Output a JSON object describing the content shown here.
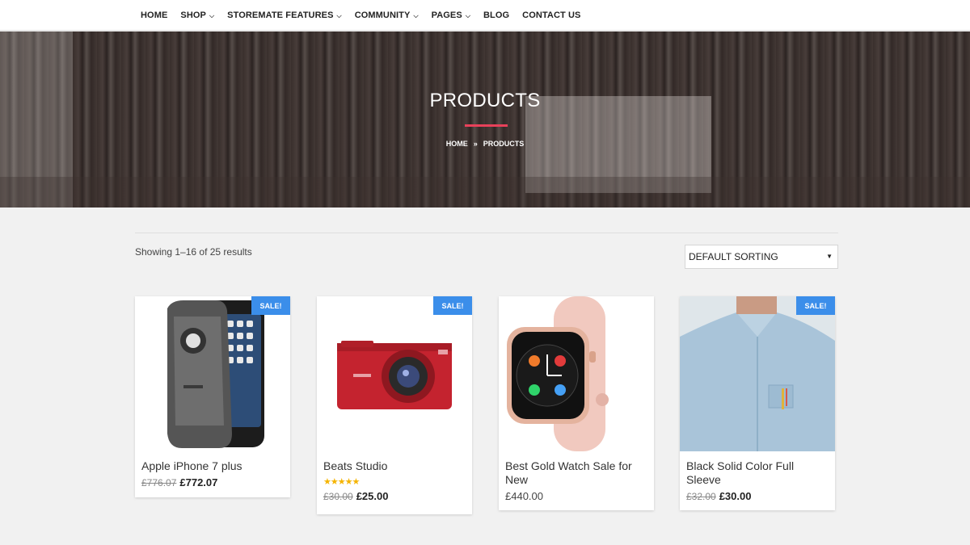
{
  "nav": {
    "items": [
      {
        "label": "HOME",
        "dropdown": false
      },
      {
        "label": "SHOP",
        "dropdown": true
      },
      {
        "label": "STOREMATE FEATURES",
        "dropdown": true
      },
      {
        "label": "COMMUNITY",
        "dropdown": true
      },
      {
        "label": "PAGES",
        "dropdown": true
      },
      {
        "label": "BLOG",
        "dropdown": false
      },
      {
        "label": "CONTACT US",
        "dropdown": false
      }
    ]
  },
  "hero": {
    "title": "PRODUCTS",
    "breadcrumb": {
      "home": "HOME",
      "current": "PRODUCTS"
    },
    "accent_color": "#e8415a"
  },
  "toolbar": {
    "results_text": "Showing 1–16 of 25 results",
    "sorting_value": "DEFAULT SORTING"
  },
  "products": [
    {
      "name": "Apple iPhone 7 plus",
      "sale_badge": "SALE!",
      "old_price": "£776.07",
      "price": "£772.07",
      "rating_stars": 0
    },
    {
      "name": "Beats Studio",
      "sale_badge": "SALE!",
      "old_price": "£30.00",
      "price": "£25.00",
      "rating_stars": 5
    },
    {
      "name": "Best Gold Watch Sale for New",
      "sale_badge": "",
      "old_price": "",
      "price": "£440.00",
      "rating_stars": 0
    },
    {
      "name": "Black Solid Color Full Sleeve",
      "sale_badge": "SALE!",
      "old_price": "£32.00",
      "price": "£30.00",
      "rating_stars": 0
    }
  ],
  "colors": {
    "sale_badge": "#3b8eea",
    "accent": "#e8415a"
  }
}
